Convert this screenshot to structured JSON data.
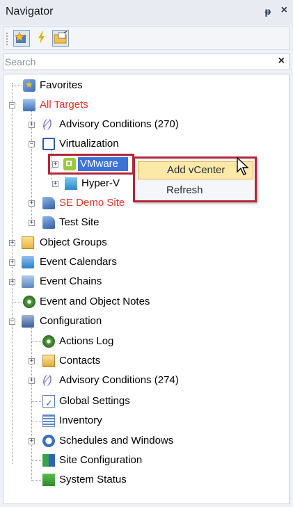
{
  "navigator": {
    "title": "Navigator",
    "pin_icon": "pin-icon",
    "close_icon": "close-icon"
  },
  "toolbar": {
    "buttons": [
      {
        "icon": "favorites-targets-icon"
      },
      {
        "icon": "lightning-icon"
      },
      {
        "icon": "folder-note-icon"
      }
    ]
  },
  "search": {
    "placeholder": "Search",
    "value": "",
    "clear_icon": "clear-icon"
  },
  "tree": {
    "favorites": "Favorites",
    "all_targets": "All Targets",
    "advisory_1": "Advisory Conditions (270)",
    "virtualization": "Virtualization",
    "vmware": "VMware",
    "hyperv": "Hyper-V",
    "se_demo_site": "SE Demo Site",
    "test_site": "Test Site",
    "object_groups": "Object Groups",
    "event_calendars": "Event Calendars",
    "event_chains": "Event Chains",
    "event_notes": "Event and Object Notes",
    "configuration": "Configuration",
    "actions_log": "Actions Log",
    "contacts": "Contacts",
    "advisory_2": "Advisory Conditions (274)",
    "global_settings": "Global Settings",
    "inventory": "Inventory",
    "schedules": "Schedules and Windows",
    "site_configuration": "Site Configuration",
    "system_status": "System Status"
  },
  "context_menu": {
    "items": [
      "Add vCenter",
      "Refresh"
    ],
    "highlighted": "Add vCenter"
  },
  "colors": {
    "highlight_red": "#b3263a",
    "selection_blue": "#3c73d6",
    "red_text": "#e0322a"
  }
}
